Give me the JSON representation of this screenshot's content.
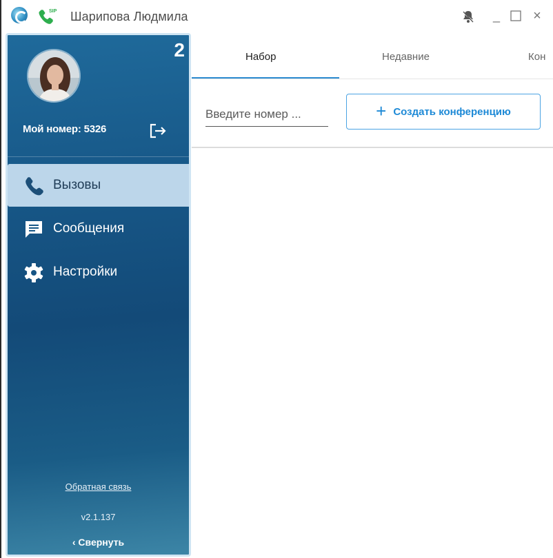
{
  "window": {
    "title": "Шарипова Людмила",
    "controls": {
      "minimize": "_",
      "maximize": "□",
      "close": "×"
    }
  },
  "sidebar": {
    "badge": "2",
    "my_number_label": "Мой номер: 5326",
    "nav": [
      {
        "label": "Вызовы",
        "icon": "phone-icon",
        "active": true
      },
      {
        "label": "Сообщения",
        "icon": "message-icon",
        "active": false
      },
      {
        "label": "Настройки",
        "icon": "gear-icon",
        "active": false
      }
    ],
    "feedback": "Обратная связь",
    "version": "v2.1.137",
    "collapse": "Свернуть",
    "collapse_icon": "‹"
  },
  "tabs": [
    {
      "label": "Набор",
      "active": true
    },
    {
      "label": "Недавние",
      "active": false
    },
    {
      "label": "Кон",
      "active": false
    }
  ],
  "dialer": {
    "placeholder": "Введите номер ...",
    "conference_button": "Создать конференцию",
    "conference_plus": "+"
  },
  "colors": {
    "accent": "#2a8ad0",
    "sidebar_top": "#1f6a9b",
    "sidebar_bottom": "#3c85a6",
    "active_nav_bg": "#bcd6ea"
  }
}
